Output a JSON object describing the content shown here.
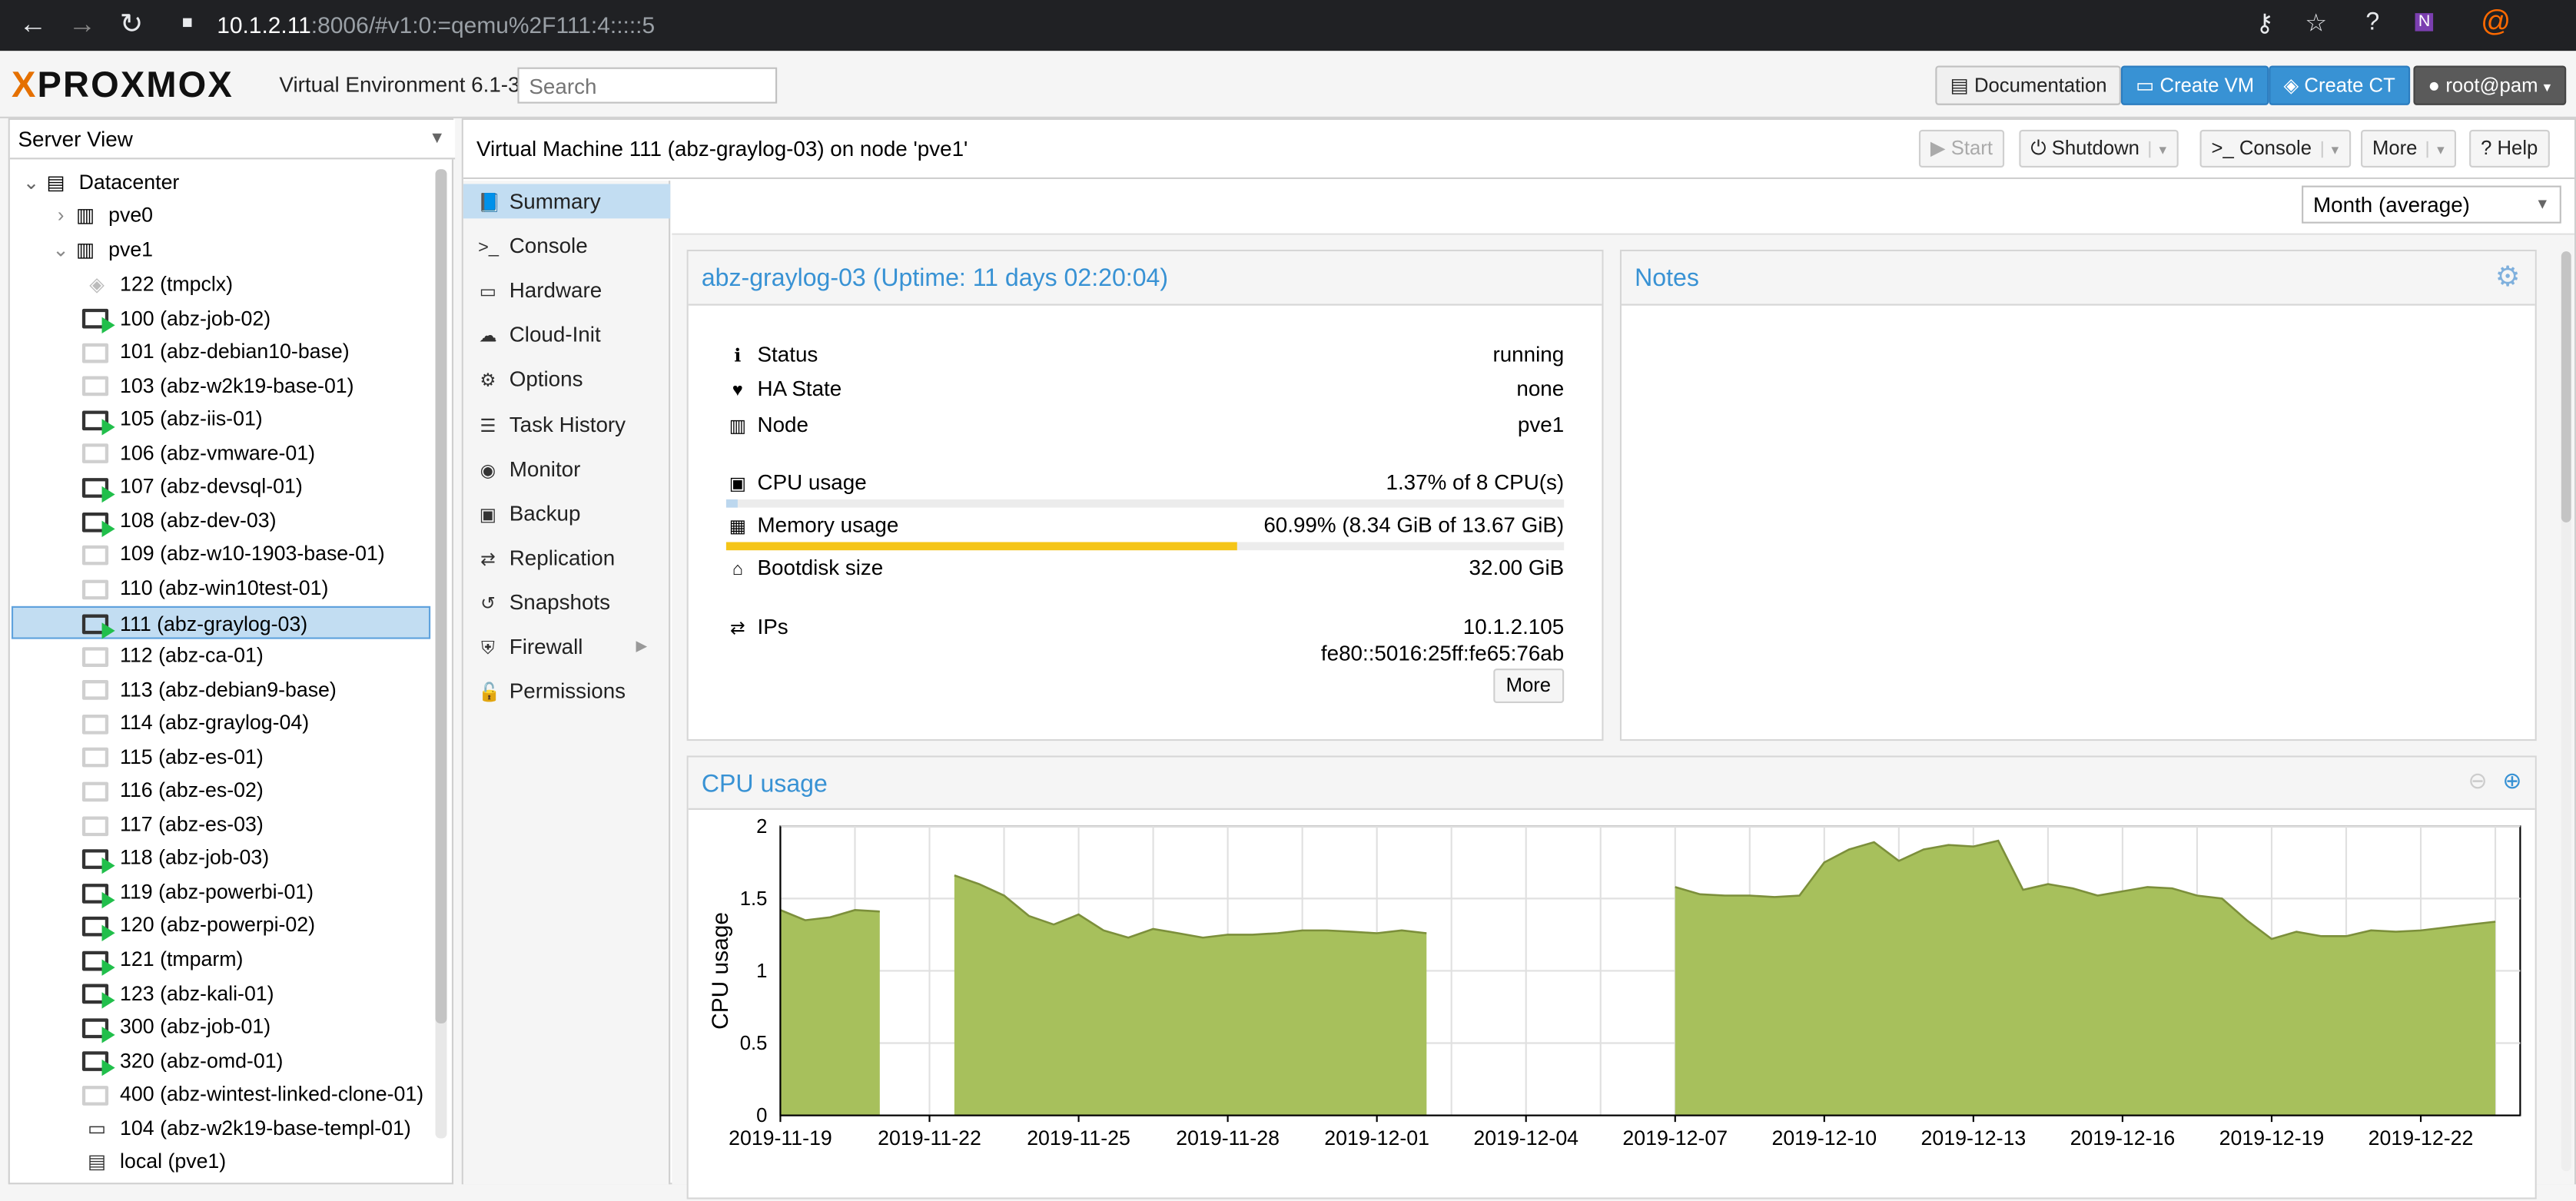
{
  "browser": {
    "url_host": "10.1.2.11",
    "url_rest": ":8006/#v1:0:=qemu%2F111:4:::::5"
  },
  "header": {
    "logo_text": "PROXMOX",
    "version": "Virtual Environment 6.1-3",
    "search_placeholder": "Search",
    "documentation": "Documentation",
    "create_vm": "Create VM",
    "create_ct": "Create CT",
    "user": "root@pam"
  },
  "tree": {
    "view": "Server View",
    "datacenter": "Datacenter",
    "nodes": [
      {
        "label": "pve0"
      },
      {
        "label": "pve1"
      }
    ],
    "items": [
      {
        "label": "122 (tmpclx)",
        "type": "ct",
        "running": false
      },
      {
        "label": "100 (abz-job-02)",
        "type": "vm",
        "running": true
      },
      {
        "label": "101 (abz-debian10-base)",
        "type": "vm",
        "running": false
      },
      {
        "label": "103 (abz-w2k19-base-01)",
        "type": "vm",
        "running": false
      },
      {
        "label": "105 (abz-iis-01)",
        "type": "vm",
        "running": true
      },
      {
        "label": "106 (abz-vmware-01)",
        "type": "vm",
        "running": false
      },
      {
        "label": "107 (abz-devsql-01)",
        "type": "vm",
        "running": true
      },
      {
        "label": "108 (abz-dev-03)",
        "type": "vm",
        "running": true
      },
      {
        "label": "109 (abz-w10-1903-base-01)",
        "type": "vm",
        "running": false
      },
      {
        "label": "110 (abz-win10test-01)",
        "type": "vm",
        "running": false
      },
      {
        "label": "111 (abz-graylog-03)",
        "type": "vm",
        "running": true,
        "selected": true
      },
      {
        "label": "112 (abz-ca-01)",
        "type": "vm",
        "running": false
      },
      {
        "label": "113 (abz-debian9-base)",
        "type": "vm",
        "running": false
      },
      {
        "label": "114 (abz-graylog-04)",
        "type": "vm",
        "running": false
      },
      {
        "label": "115 (abz-es-01)",
        "type": "vm",
        "running": false
      },
      {
        "label": "116 (abz-es-02)",
        "type": "vm",
        "running": false
      },
      {
        "label": "117 (abz-es-03)",
        "type": "vm",
        "running": false
      },
      {
        "label": "118 (abz-job-03)",
        "type": "vm",
        "running": true
      },
      {
        "label": "119 (abz-powerbi-01)",
        "type": "vm",
        "running": true
      },
      {
        "label": "120 (abz-powerpi-02)",
        "type": "vm",
        "running": true
      },
      {
        "label": "121 (tmparm)",
        "type": "vm",
        "running": true
      },
      {
        "label": "123 (abz-kali-01)",
        "type": "vm",
        "running": true
      },
      {
        "label": "300 (abz-job-01)",
        "type": "vm",
        "running": true
      },
      {
        "label": "320 (abz-omd-01)",
        "type": "vm",
        "running": true
      },
      {
        "label": "400 (abz-wintest-linked-clone-01)",
        "type": "vm",
        "running": false
      },
      {
        "label": "104 (abz-w2k19-base-templ-01)",
        "type": "template",
        "running": false
      },
      {
        "label": "local (pve1)",
        "type": "storage",
        "running": false
      }
    ]
  },
  "titlebar": {
    "title": "Virtual Machine 111 (abz-graylog-03) on node 'pve1'",
    "start": "Start",
    "shutdown": "Shutdown",
    "console": "Console",
    "more": "More",
    "help": "Help"
  },
  "menu": [
    {
      "label": "Summary",
      "icon": "book-icon",
      "glyph": "📘"
    },
    {
      "label": "Console",
      "icon": "terminal-icon",
      "glyph": ">_"
    },
    {
      "label": "Hardware",
      "icon": "monitor-icon",
      "glyph": "▭"
    },
    {
      "label": "Cloud-Init",
      "icon": "cloud-icon",
      "glyph": "☁"
    },
    {
      "label": "Options",
      "icon": "gear-icon",
      "glyph": "⚙"
    },
    {
      "label": "Task History",
      "icon": "list-icon",
      "glyph": "☰"
    },
    {
      "label": "Monitor",
      "icon": "eye-icon",
      "glyph": "◉"
    },
    {
      "label": "Backup",
      "icon": "floppy-icon",
      "glyph": "▣"
    },
    {
      "label": "Replication",
      "icon": "retweet-icon",
      "glyph": "⇄"
    },
    {
      "label": "Snapshots",
      "icon": "history-icon",
      "glyph": "↺"
    },
    {
      "label": "Firewall",
      "icon": "shield-icon",
      "glyph": "⛨"
    },
    {
      "label": "Permissions",
      "icon": "unlock-icon",
      "glyph": "🔓"
    }
  ],
  "timeframe": "Month (average)",
  "status_panel": {
    "title": "abz-graylog-03 (Uptime: 11 days 02:20:04)",
    "status_label": "Status",
    "status_value": "running",
    "ha_label": "HA State",
    "ha_value": "none",
    "node_label": "Node",
    "node_value": "pve1",
    "cpu_label": "CPU usage",
    "cpu_value": "1.37% of 8 CPU(s)",
    "cpu_fraction": 0.0137,
    "mem_label": "Memory usage",
    "mem_value": "60.99% (8.34 GiB of 13.67 GiB)",
    "mem_fraction": 0.6099,
    "disk_label": "Bootdisk size",
    "disk_value": "32.00 GiB",
    "ips_label": "IPs",
    "ip1": "10.1.2.105",
    "ip2": "fe80::5016:25ff:fe65:76ab",
    "more": "More",
    "mem_color": "#f5c518",
    "cpu_color": "#bcd7ee"
  },
  "notes_panel": {
    "title": "Notes"
  },
  "cpu_chart": {
    "title": "CPU usage",
    "fill_color": "#a7c05c",
    "stroke_color": "#7c8f3b"
  },
  "chart_data": {
    "type": "area",
    "ylabel": "CPU usage",
    "ylim": [
      0,
      2
    ],
    "yticks": [
      "0",
      "0.5",
      "1",
      "1.5",
      "2"
    ],
    "xticks": [
      "2019-11-19",
      "2019-11-22",
      "2019-11-25",
      "2019-11-28",
      "2019-12-01",
      "2019-12-04",
      "2019-12-07",
      "2019-12-10",
      "2019-12-13",
      "2019-12-16",
      "2019-12-19",
      "2019-12-22"
    ],
    "x_start": "2019-11-19",
    "x_end": "2019-12-24",
    "segments": [
      [
        [
          "2019-11-19",
          1.42
        ],
        [
          "2019-11-19T12",
          1.35
        ],
        [
          "2019-11-20",
          1.37
        ],
        [
          "2019-11-20T12",
          1.42
        ],
        [
          "2019-11-21",
          1.41
        ]
      ],
      [
        [
          "2019-11-22T12",
          1.66
        ],
        [
          "2019-11-23",
          1.6
        ],
        [
          "2019-11-23T12",
          1.52
        ],
        [
          "2019-11-24",
          1.38
        ],
        [
          "2019-11-24T12",
          1.32
        ],
        [
          "2019-11-25",
          1.39
        ],
        [
          "2019-11-25T12",
          1.28
        ],
        [
          "2019-11-26",
          1.23
        ],
        [
          "2019-11-26T12",
          1.29
        ],
        [
          "2019-11-27",
          1.26
        ],
        [
          "2019-11-27T12",
          1.23
        ],
        [
          "2019-11-28",
          1.25
        ],
        [
          "2019-11-28T12",
          1.25
        ],
        [
          "2019-11-29",
          1.26
        ],
        [
          "2019-11-29T12",
          1.28
        ],
        [
          "2019-11-30",
          1.28
        ],
        [
          "2019-11-30T12",
          1.27
        ],
        [
          "2019-12-01",
          1.26
        ],
        [
          "2019-12-01T12",
          1.28
        ],
        [
          "2019-12-02",
          1.26
        ]
      ],
      [
        [
          "2019-12-07",
          1.58
        ],
        [
          "2019-12-07T12",
          1.53
        ],
        [
          "2019-12-08",
          1.52
        ],
        [
          "2019-12-08T12",
          1.52
        ],
        [
          "2019-12-09",
          1.51
        ],
        [
          "2019-12-09T12",
          1.52
        ],
        [
          "2019-12-10",
          1.75
        ],
        [
          "2019-12-10T12",
          1.84
        ],
        [
          "2019-12-11",
          1.89
        ],
        [
          "2019-12-11T12",
          1.76
        ],
        [
          "2019-12-12",
          1.84
        ],
        [
          "2019-12-12T12",
          1.87
        ],
        [
          "2019-12-13",
          1.86
        ],
        [
          "2019-12-13T12",
          1.9
        ],
        [
          "2019-12-14",
          1.56
        ],
        [
          "2019-12-14T12",
          1.6
        ],
        [
          "2019-12-15",
          1.57
        ],
        [
          "2019-12-15T12",
          1.52
        ],
        [
          "2019-12-16",
          1.55
        ],
        [
          "2019-12-16T12",
          1.58
        ],
        [
          "2019-12-17",
          1.57
        ],
        [
          "2019-12-17T12",
          1.52
        ],
        [
          "2019-12-18",
          1.5
        ],
        [
          "2019-12-18T12",
          1.35
        ],
        [
          "2019-12-19",
          1.22
        ],
        [
          "2019-12-19T12",
          1.27
        ],
        [
          "2019-12-20",
          1.24
        ],
        [
          "2019-12-20T12",
          1.24
        ],
        [
          "2019-12-21",
          1.28
        ],
        [
          "2019-12-21T12",
          1.27
        ],
        [
          "2019-12-22",
          1.28
        ],
        [
          "2019-12-22T12",
          1.3
        ],
        [
          "2019-12-23",
          1.32
        ],
        [
          "2019-12-23T12",
          1.34
        ]
      ]
    ]
  }
}
